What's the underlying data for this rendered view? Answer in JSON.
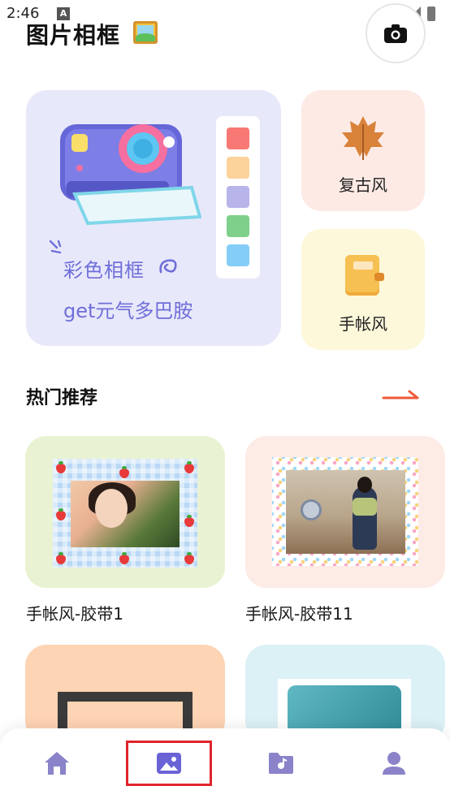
{
  "status_bar": {
    "time": "2:46",
    "notif_badge": "A"
  },
  "header": {
    "title": "图片相框",
    "title_emoji": "framed-picture-emoji"
  },
  "hero_card": {
    "line1": "彩色相框",
    "line2": "get元气多巴胺",
    "swatch_colors": [
      "#f77874",
      "#fbd39b",
      "#b8b5ea",
      "#7ed08a",
      "#84cdf8"
    ]
  },
  "side_cards": [
    {
      "label": "复古风",
      "icon": "maple-leaf-icon"
    },
    {
      "label": "手帐风",
      "icon": "notebook-icon"
    }
  ],
  "section": {
    "title": "热门推荐",
    "more_icon": "arrow-right-icon"
  },
  "templates": [
    {
      "name": "手帐风-胶带1"
    },
    {
      "name": "手帐风-胶带11"
    }
  ],
  "bottom_nav": {
    "items": [
      "home-icon",
      "gallery-icon",
      "folder-icon",
      "profile-icon"
    ],
    "active": "gallery-icon",
    "active_color": "#e0242c"
  },
  "colors": {
    "accent": "#6f6fd9",
    "arrow": "#ef5a3a",
    "nav_icon": "#8a83c9",
    "nav_active_icon": "#6a63d6"
  }
}
